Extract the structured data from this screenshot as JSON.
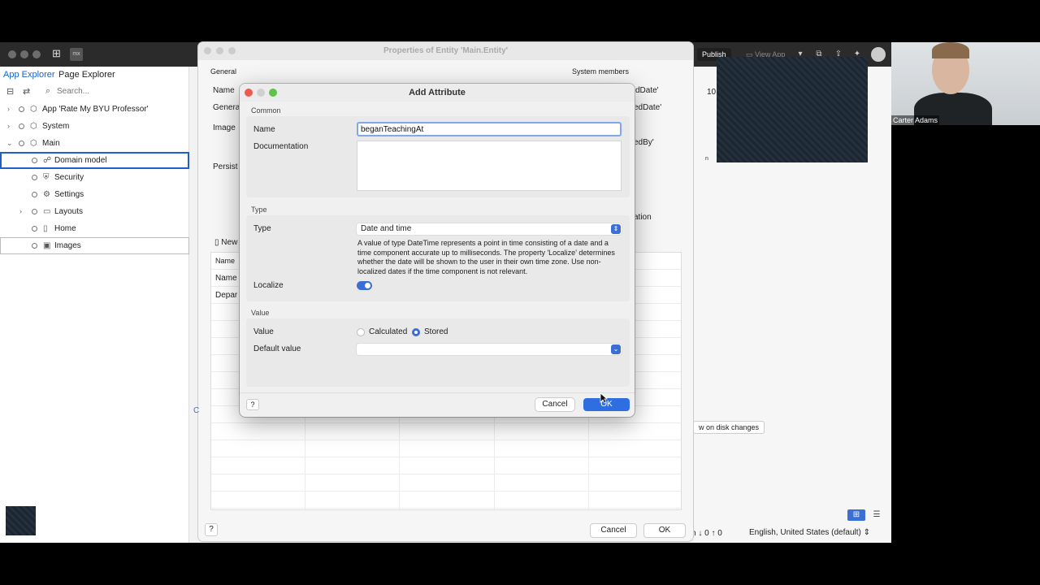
{
  "studio": {
    "publish_label": "Publish",
    "view_app_label": "View App",
    "logo": "mx"
  },
  "explorer": {
    "tab_app": "App Explorer",
    "tab_page": "Page Explorer",
    "search_placeholder": "Search...",
    "tree": [
      {
        "label": "App 'Rate My BYU Professor'",
        "icon": "app-icon"
      },
      {
        "label": "System",
        "icon": "module-icon"
      },
      {
        "label": "Main",
        "icon": "module-icon"
      },
      {
        "label": "Domain model",
        "icon": "domain-model-icon"
      },
      {
        "label": "Security",
        "icon": "security-icon"
      },
      {
        "label": "Settings",
        "icon": "gear-icon"
      },
      {
        "label": "Layouts",
        "icon": "folder-icon"
      },
      {
        "label": "Home",
        "icon": "page-icon"
      },
      {
        "label": "Images",
        "icon": "images-icon"
      }
    ]
  },
  "properties": {
    "title": "Properties of Entity 'Main.Entity'",
    "general": "General",
    "name": "Name",
    "generalization": "Genera",
    "image": "Image",
    "persistable": "Persist",
    "system_members": "System members",
    "sys1": "dDate'",
    "sys2": "edDate'",
    "sys3": "edBy'",
    "sys_value": "10",
    "tab_partial": "ation",
    "new_label": "New",
    "col_name": "Name",
    "row1": "Name",
    "row2": "Depar",
    "partial_c": "C",
    "help": "?",
    "cancel": "Cancel",
    "ok": "OK"
  },
  "right_panel": {
    "disk_button": "w on disk changes",
    "partial_n": "n",
    "status": "n  ↓ 0  ↑ 0",
    "language": "English, United States (default)"
  },
  "video": {
    "person_name": "Carter Adams"
  },
  "dialog": {
    "title": "Add Attribute",
    "common_section": "Common",
    "name_label": "Name",
    "name_value": "beganTeachingAt",
    "documentation_label": "Documentation",
    "documentation_value": "",
    "type_section": "Type",
    "type_label": "Type",
    "type_value": "Date and time",
    "type_description": "A value of type DateTime represents a point in time consisting of a date and a time component accurate up to milliseconds. The property 'Localize' determines whether the date will be shown to the user in their own time zone. Use non-localized dates if the time component is not relevant.",
    "localize_label": "Localize",
    "localize_on": true,
    "value_section": "Value",
    "value_label": "Value",
    "value_option_calculated": "Calculated",
    "value_option_stored": "Stored",
    "value_selected": "Stored",
    "default_value_label": "Default value",
    "default_value": "",
    "help": "?",
    "cancel": "Cancel",
    "ok": "OK"
  },
  "colors": {
    "accent": "#2f6ee0",
    "selection_border": "#1f5fc9",
    "close": "#ee5a52",
    "maximize": "#5ec449"
  }
}
